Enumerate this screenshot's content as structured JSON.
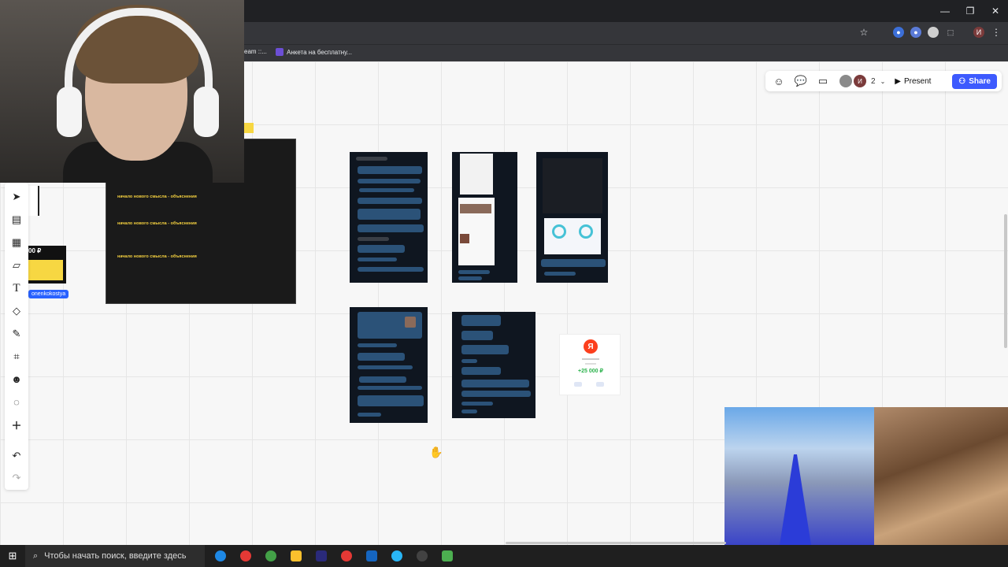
{
  "browser": {
    "bookmarks": [
      "eam ::...",
      "Анкета на бесплатну..."
    ],
    "window_controls": [
      "—",
      "❐",
      "✕"
    ],
    "profile_initial": "И"
  },
  "topbar": {
    "collaborators": [
      {
        "initial": "",
        "color": "#8a8a8a"
      },
      {
        "initial": "И",
        "color": "#7b3b3b"
      }
    ],
    "collab_count": "2",
    "present_label": "Present",
    "share_label": "Share",
    "accent": "#3d5afe"
  },
  "tools": [
    "cursor-icon",
    "templates-icon",
    "table-icon",
    "sticky-note-icon",
    "text-icon",
    "shapes-icon",
    "pen-icon",
    "frame-icon",
    "sticker-icon",
    "comment-icon",
    "add-icon",
    "undo-icon",
    "redo-icon"
  ],
  "board": {
    "note_lines": [
      "начало нового смысла - объяснения",
      "начало нового смысла - объяснения",
      "начало нового смысла - объяснения"
    ],
    "price_label": "00 ₽",
    "user_tag": "onenkokostya",
    "yandex": {
      "logo": "Я",
      "amount": "+25 000 ₽"
    }
  },
  "taskbar": {
    "search_placeholder": "Чтобы начать поиск, введите здесь",
    "apps": [
      {
        "name": "edge",
        "color": "#1e88e5"
      },
      {
        "name": "chrome-1",
        "color": "#e53935"
      },
      {
        "name": "chrome-2",
        "color": "#43a047"
      },
      {
        "name": "explorer",
        "color": "#fbc02d"
      },
      {
        "name": "premiere",
        "color": "#2a2a7a"
      },
      {
        "name": "chrome-3",
        "color": "#e53935"
      },
      {
        "name": "photoshop",
        "color": "#1565c0"
      },
      {
        "name": "telegram",
        "color": "#29b6f6"
      },
      {
        "name": "obs",
        "color": "#424242"
      },
      {
        "name": "minecraft",
        "color": "#4caf50"
      }
    ]
  }
}
